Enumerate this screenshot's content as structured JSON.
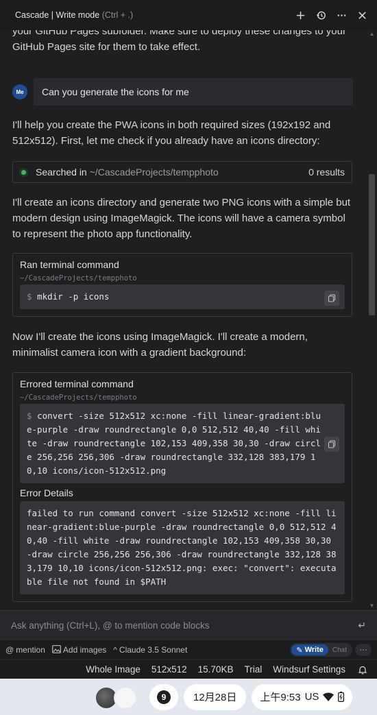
{
  "window": {
    "title": "Cascade | Write mode",
    "shortcut": "(Ctrl + .)"
  },
  "chat": {
    "intro_text": "your GitHub Pages subfolder. Make sure to deploy these changes to your GitHub Pages site for them to take effect.",
    "user": {
      "avatar": "Me",
      "message": "Can you generate the icons for me"
    },
    "reply1": "I'll help you create the PWA icons in both required sizes (192x192 and 512x512). First, let me check if you already have an icons directory:",
    "search": {
      "label": "Searched in",
      "path": "~/CascadeProjects/tempphoto",
      "results": "0 results"
    },
    "reply2": "I'll create an icons directory and generate two PNG icons with a simple but modern design using ImageMagick. The icons will have a camera symbol to represent the photo app functionality.",
    "term1": {
      "label": "Ran terminal command",
      "cwd": "~/CascadeProjects/tempphoto",
      "prompt": "$",
      "command": "mkdir -p icons"
    },
    "reply3": "Now I'll create the icons using ImageMagick. I'll create a modern, minimalist camera icon with a gradient background:",
    "term2": {
      "label": "Errored terminal command",
      "cwd": "~/CascadeProjects/tempphoto",
      "prompt": "$",
      "command": "convert -size 512x512 xc:none -fill linear-gradient:blue-purple -draw roundrectangle 0,0 512,512 40,40 -fill white -draw roundrectangle 102,153 409,358 30,30 -draw circle 256,256 256,306 -draw roundrectangle 332,128 383,179 10,10 icons/icon-512x512.png",
      "error_label": "Error Details",
      "error_text": "failed to run command convert -size 512x512 xc:none -fill linear-gradient:blue-purple -draw roundrectangle 0,0 512,512 40,40 -fill white -draw roundrectangle 102,153 409,358 30,30 -draw circle 256,256 256,306 -draw roundrectangle 332,128 383,179 10,10 icons/icon-512x512.png: exec: \"convert\": executable file not found in $PATH"
    }
  },
  "input": {
    "placeholder": "Ask anything (Ctrl+L), @ to mention code blocks"
  },
  "toolbar": {
    "mention": "mention",
    "add_images": "Add images",
    "model": "Claude 3.5 Sonnet",
    "write": "Write",
    "chat": "Chat",
    "more": "···"
  },
  "statusbar": {
    "items": [
      "Whole Image",
      "512x512",
      "15.70KB",
      "Trial",
      "Windsurf Settings"
    ]
  },
  "shelf": {
    "notifications": "9",
    "date": "12月28日",
    "time": "上午9:53",
    "locale": "US"
  },
  "colors": {
    "accent": "#1e4e8f",
    "success": "#3fb950",
    "background": "#1f1f22"
  }
}
